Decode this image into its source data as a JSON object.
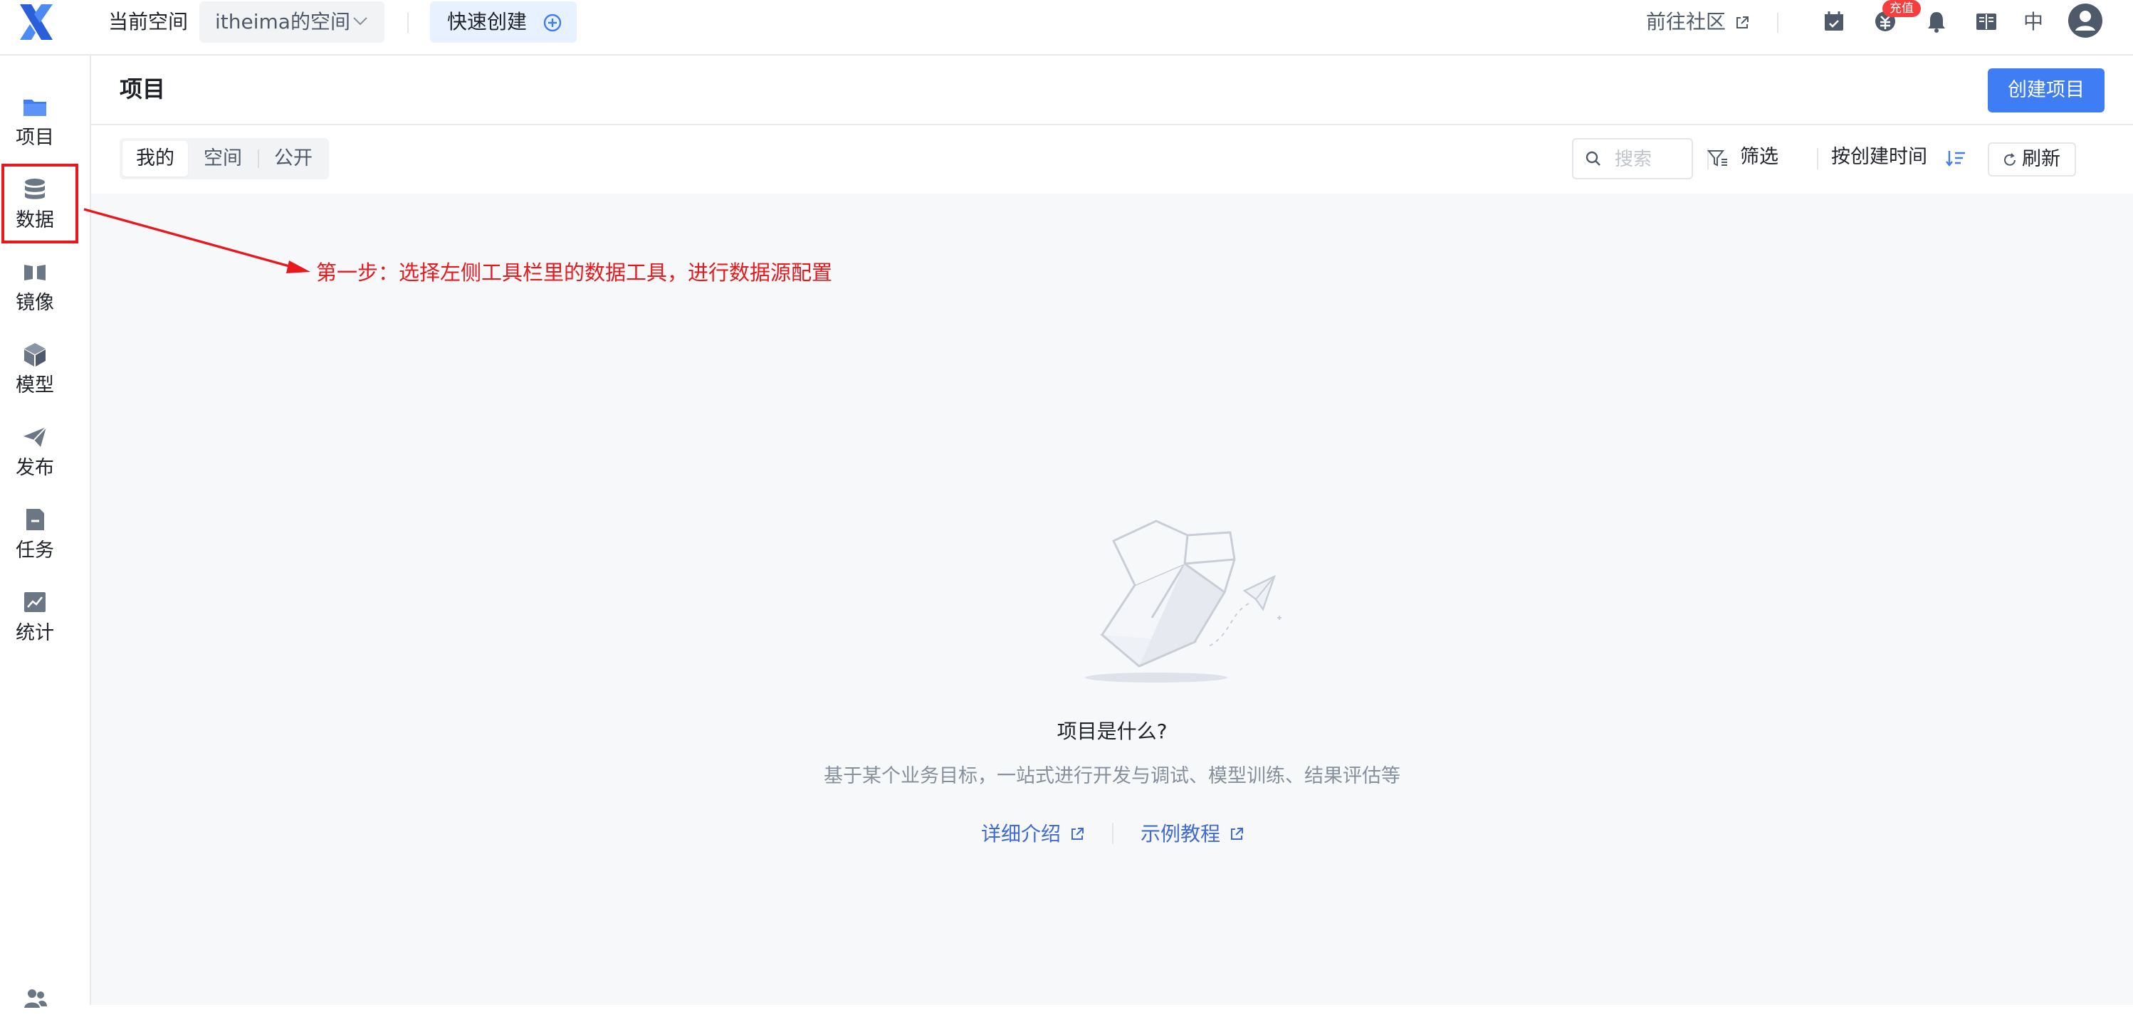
{
  "topbar": {
    "current_space_label": "当前空间",
    "space_name": "itheima的空间",
    "quick_create": "快速创建",
    "community_link": "前往社区",
    "recharge_badge": "充值",
    "language": "中"
  },
  "sidebar": {
    "items": [
      {
        "label": "项目",
        "icon": "folder-icon"
      },
      {
        "label": "数据",
        "icon": "database-icon"
      },
      {
        "label": "镜像",
        "icon": "mirror-icon"
      },
      {
        "label": "模型",
        "icon": "cube-icon"
      },
      {
        "label": "发布",
        "icon": "send-icon"
      },
      {
        "label": "任务",
        "icon": "task-icon"
      },
      {
        "label": "统计",
        "icon": "chart-icon"
      }
    ],
    "highlighted_index": 1
  },
  "page": {
    "title": "项目",
    "create_button": "创建项目"
  },
  "toolbar": {
    "tabs": [
      "我的",
      "空间",
      "公开"
    ],
    "active_tab": 0,
    "search_placeholder": "搜索",
    "filter_label": "筛选",
    "sort_label": "按创建时间",
    "refresh_label": "刷新"
  },
  "empty_state": {
    "title": "项目是什么?",
    "description": "基于某个业务目标，一站式进行开发与调试、模型训练、结果评估等",
    "links": [
      "详细介绍",
      "示例教程"
    ]
  },
  "annotation": {
    "text": "第一步：选择左侧工具栏里的数据工具，进行数据源配置"
  },
  "colors": {
    "accent": "#3f7df5",
    "annotation_red": "#e8181d",
    "content_bg": "#f7f8fa"
  }
}
